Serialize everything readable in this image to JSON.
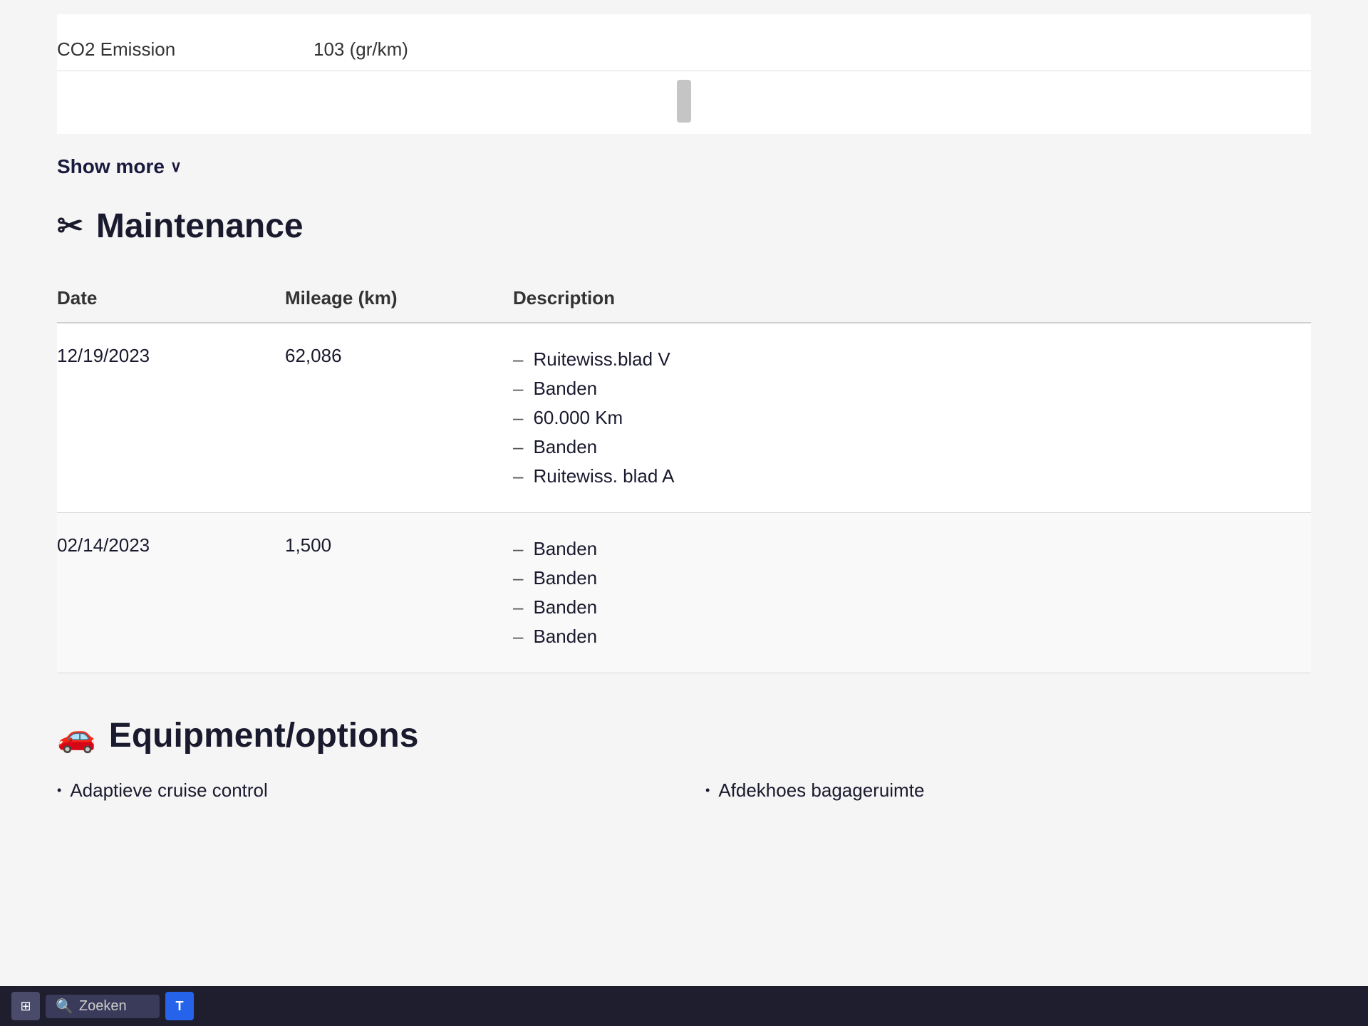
{
  "top": {
    "co2_label": "CO2 Emission",
    "co2_value": "103 (gr/km)"
  },
  "show_more": {
    "label": "Show more",
    "chevron": "∨"
  },
  "maintenance": {
    "icon": "✂",
    "title": "Maintenance",
    "columns": [
      "Date",
      "Mileage (km)",
      "Description"
    ],
    "rows": [
      {
        "date": "12/19/2023",
        "mileage": "62,086",
        "descriptions": [
          "Ruitewiss.blad V",
          "Banden",
          "60.000 Km",
          "Banden",
          "Ruitewiss. blad A"
        ]
      },
      {
        "date": "02/14/2023",
        "mileage": "1,500",
        "descriptions": [
          "Banden",
          "Banden",
          "Banden",
          "Banden"
        ]
      }
    ]
  },
  "equipment": {
    "icon": "🚗",
    "title": "Equipment/options",
    "items_left": [
      "Adaptieve cruise control"
    ],
    "items_right": [
      "Afdekhoes bagageruimte"
    ]
  },
  "taskbar": {
    "search_placeholder": "Zoeken",
    "ms_label": "T"
  }
}
